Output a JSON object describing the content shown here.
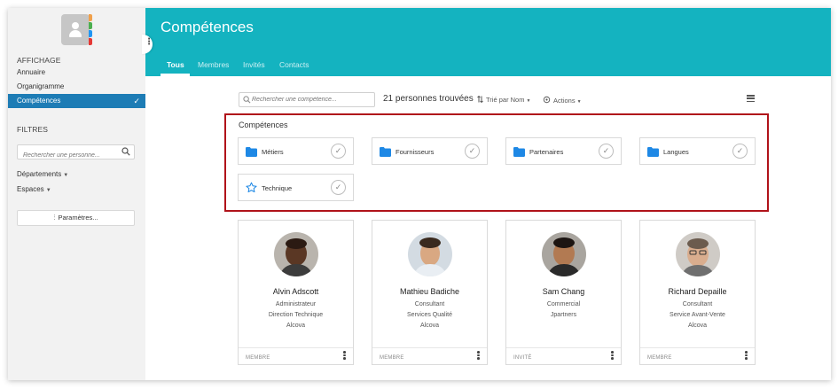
{
  "sidebar": {
    "affichage_title": "AFFICHAGE",
    "nav": [
      {
        "label": "Annuaire"
      },
      {
        "label": "Organigramme"
      },
      {
        "label": "Compétences",
        "check": "✓"
      }
    ],
    "filters_title": "FILTRES",
    "person_search_placeholder": "Rechercher une personne...",
    "filters": [
      {
        "label": "Départements"
      },
      {
        "label": "Espaces"
      }
    ],
    "params_label": "Paramètres..."
  },
  "header": {
    "title": "Compétences",
    "tabs": [
      {
        "label": "Tous"
      },
      {
        "label": "Membres"
      },
      {
        "label": "Invités"
      },
      {
        "label": "Contacts"
      }
    ]
  },
  "toolbar": {
    "skill_search_placeholder": "Rechercher une compétence...",
    "result_count": "21 personnes trouvées",
    "sort_label": "Trié par Nom",
    "actions_label": "Actions"
  },
  "competences": {
    "title": "Compétences",
    "items": [
      {
        "label": "Métiers",
        "icon": "folder-icon"
      },
      {
        "label": "Fournisseurs",
        "icon": "folder-icon"
      },
      {
        "label": "Partenaires",
        "icon": "folder-icon"
      },
      {
        "label": "Langues",
        "icon": "folder-icon"
      },
      {
        "label": "Technique",
        "icon": "star-icon"
      }
    ]
  },
  "people": [
    {
      "name": "Alvin Adscott",
      "title": "Administrateur",
      "department": "Direction Technique",
      "company": "Alcova",
      "role": "MEMBRE"
    },
    {
      "name": "Mathieu Badiche",
      "title": "Consultant",
      "department": "Services Qualité",
      "company": "Alcova",
      "role": "MEMBRE"
    },
    {
      "name": "Sam Chang",
      "title": "Commercial",
      "department": "Jpartners",
      "company": "",
      "role": "INVITÉ"
    },
    {
      "name": "Richard Depaille",
      "title": "Consultant",
      "department": "Service Avant-Vente",
      "company": "Alcova",
      "role": "MEMBRE"
    }
  ],
  "colors": {
    "header": "#14b3c0",
    "active_nav": "#1d7cb5",
    "folder": "#1e88e5",
    "highlight_box": "#b0131a"
  }
}
